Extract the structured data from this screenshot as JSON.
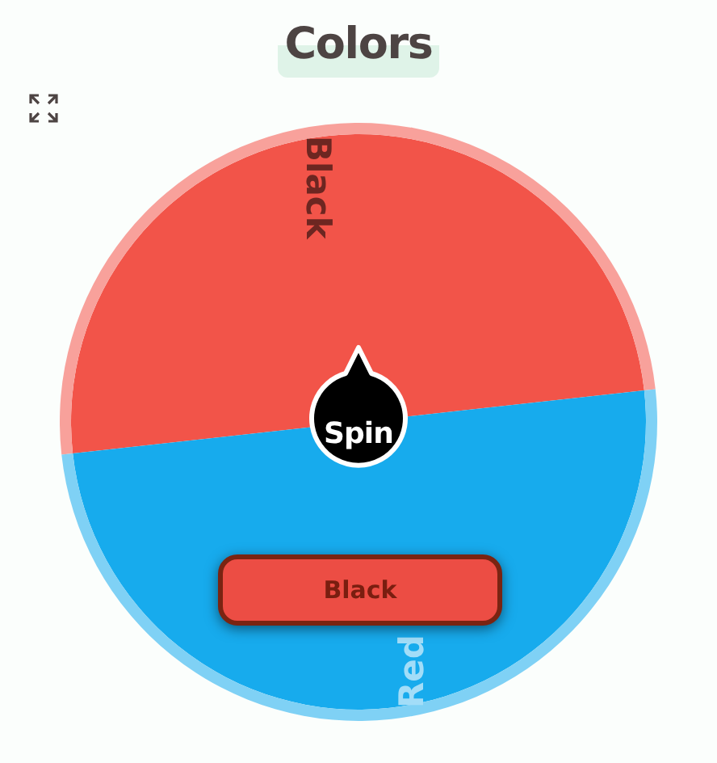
{
  "title": "Colors",
  "segments": [
    {
      "label": "Black",
      "color": "#f25449"
    },
    {
      "label": "Red",
      "color": "#17abed"
    }
  ],
  "spin_button": {
    "label": "Spin"
  },
  "result": {
    "label": "Black",
    "color": "#ec4d44"
  }
}
